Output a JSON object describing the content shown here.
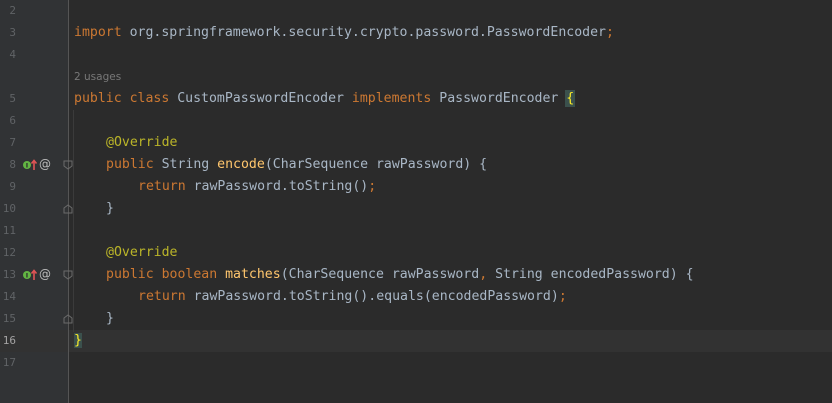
{
  "editor": {
    "line_numbers": [
      "2",
      "3",
      "4",
      "5",
      "6",
      "7",
      "8",
      "9",
      "10",
      "11",
      "12",
      "13",
      "14",
      "15",
      "16",
      "17"
    ],
    "usages_hint": "2 usages",
    "lines": {
      "l3": {
        "kw": "import",
        "rest": " org.springframework.security.crypto.password.PasswordEncoder",
        "semi": ";"
      },
      "l5": {
        "kw1": "public class",
        "name": " CustomPasswordEncoder ",
        "kw2": "implements",
        "iface": " PasswordEncoder ",
        "brace": "{"
      },
      "l7": {
        "ann": "@Override"
      },
      "l8": {
        "kw": "public",
        "type": " String ",
        "fn": "encode",
        "params": "(CharSequence rawPassword) {"
      },
      "l9": {
        "kw": "return",
        "rest": " rawPassword.toString()",
        "semi": ";"
      },
      "l10": {
        "text": "}"
      },
      "l12": {
        "ann": "@Override"
      },
      "l13": {
        "kw": "public boolean",
        "sp": " ",
        "fn": "matches",
        "p1": "(CharSequence rawPassword",
        "comma": ",",
        "p2": " String encodedPassword) {"
      },
      "l14": {
        "kw": "return",
        "rest": " rawPassword.toString().equals(encodedPassword)",
        "semi": ";"
      },
      "l15": {
        "text": "}"
      },
      "l16": {
        "text": "}"
      }
    },
    "gutter_icons": {
      "implements_icon": "implements-method-icon",
      "override_icon": "at-override-icon",
      "at_glyph": "@"
    },
    "colors": {
      "background": "#2b2b2b",
      "keyword": "#cc7832",
      "function": "#ffc66d",
      "annotation": "#bbb529",
      "text": "#a9b7c6"
    }
  }
}
